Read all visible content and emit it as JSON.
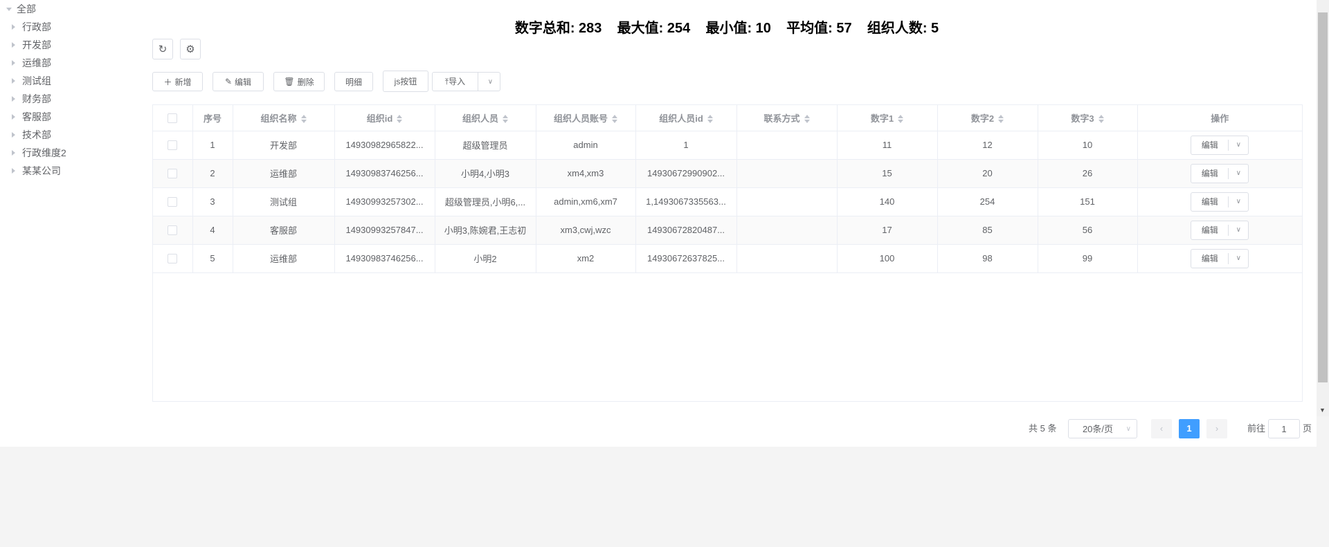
{
  "tree": {
    "root": "全部",
    "children": [
      "行政部",
      "开发部",
      "运维部",
      "测试组",
      "财务部",
      "客服部",
      "技术部",
      "行政维度2",
      "某某公司"
    ]
  },
  "stats": "数字总和: 283    最大值: 254    最小值: 10    平均值: 57    组织人数: 5",
  "toolbar": {
    "add": "新增",
    "edit": "编辑",
    "delete": "删除",
    "detail": "明细",
    "js": "js按钮",
    "import": "导入"
  },
  "table": {
    "headers": [
      "序号",
      "组织名称",
      "组织id",
      "组织人员",
      "组织人员账号",
      "组织人员id",
      "联系方式",
      "数字1",
      "数字2",
      "数字3",
      "操作"
    ],
    "rows": [
      [
        "1",
        "开发部",
        "14930982965822...",
        "超级管理员",
        "admin",
        "1",
        "",
        "11",
        "12",
        "10"
      ],
      [
        "2",
        "运维部",
        "14930983746256...",
        "小明4,小明3",
        "xm4,xm3",
        "14930672990902...",
        "",
        "15",
        "20",
        "26"
      ],
      [
        "3",
        "测试组",
        "14930993257302...",
        "超级管理员,小明6,...",
        "admin,xm6,xm7",
        "1,1493067335563...",
        "",
        "140",
        "254",
        "151"
      ],
      [
        "4",
        "客服部",
        "14930993257847...",
        "小明3,陈婉君,王志初",
        "xm3,cwj,wzc",
        "14930672820487...",
        "",
        "17",
        "85",
        "56"
      ],
      [
        "5",
        "运维部",
        "14930983746256...",
        "小明2",
        "xm2",
        "14930672637825...",
        "",
        "100",
        "98",
        "99"
      ]
    ],
    "row_action": "编辑"
  },
  "pagination": {
    "total": "共 5 条",
    "page_size": "20条/页",
    "current": "1",
    "goto_label": "前往",
    "goto_value": "1",
    "page_suffix": "页"
  },
  "colors": {
    "accent": "#409eff"
  }
}
